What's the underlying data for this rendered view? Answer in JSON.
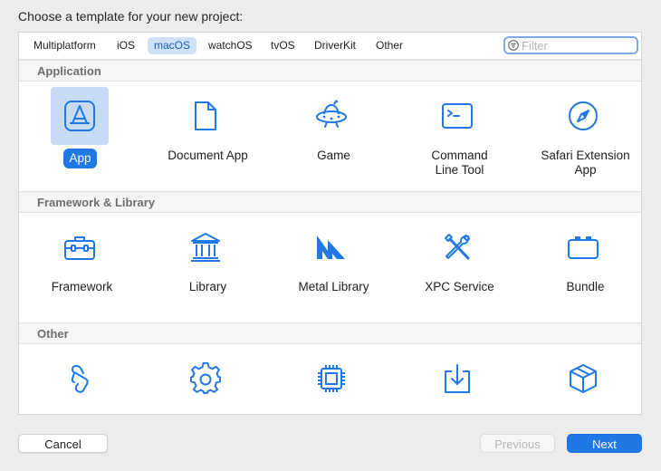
{
  "dialog": {
    "title": "Choose a template for your new project:"
  },
  "platform_tabs": [
    {
      "label": "Multiplatform",
      "selected": false
    },
    {
      "label": "iOS",
      "selected": false
    },
    {
      "label": "macOS",
      "selected": true
    },
    {
      "label": "watchOS",
      "selected": false
    },
    {
      "label": "tvOS",
      "selected": false
    },
    {
      "label": "DriverKit",
      "selected": false
    },
    {
      "label": "Other",
      "selected": false
    }
  ],
  "filter": {
    "placeholder": "Filter",
    "value": ""
  },
  "sections": [
    {
      "title": "Application",
      "items": [
        {
          "label": "App",
          "icon": "app-store-a-icon",
          "selected": true
        },
        {
          "label": "Document App",
          "icon": "document-icon",
          "selected": false
        },
        {
          "label": "Game",
          "icon": "ufo-icon",
          "selected": false
        },
        {
          "label": "Command Line Tool",
          "icon": "terminal-icon",
          "selected": false
        },
        {
          "label": "Safari Extension App",
          "icon": "compass-icon",
          "selected": false
        }
      ]
    },
    {
      "title": "Framework & Library",
      "items": [
        {
          "label": "Framework",
          "icon": "toolbox-icon",
          "selected": false
        },
        {
          "label": "Library",
          "icon": "building-columns-icon",
          "selected": false
        },
        {
          "label": "Metal Library",
          "icon": "metal-icon",
          "selected": false
        },
        {
          "label": "XPC Service",
          "icon": "tools-icon",
          "selected": false
        },
        {
          "label": "Bundle",
          "icon": "bundle-icon",
          "selected": false
        }
      ]
    },
    {
      "title": "Other",
      "items": [
        {
          "label": "",
          "icon": "scroll-icon",
          "selected": false
        },
        {
          "label": "",
          "icon": "gear-icon",
          "selected": false
        },
        {
          "label": "",
          "icon": "chip-icon",
          "selected": false
        },
        {
          "label": "",
          "icon": "download-tray-icon",
          "selected": false
        },
        {
          "label": "",
          "icon": "package-cube-icon",
          "selected": false
        }
      ]
    }
  ],
  "buttons": {
    "cancel": "Cancel",
    "previous": "Previous",
    "next": "Next"
  },
  "colors": {
    "accent": "#1f78e6",
    "selection_bg": "#c7dcf4",
    "icon": "#1f78e6"
  }
}
